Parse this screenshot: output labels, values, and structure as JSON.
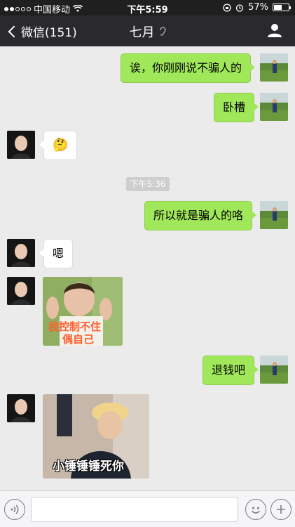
{
  "status_bar": {
    "carrier": "中国移动",
    "time": "下午5:59",
    "battery": "57%",
    "battery_level": 0.57
  },
  "nav": {
    "back_label": "微信(151)",
    "title": "七月"
  },
  "messages": {
    "m1": "诶，你刚刚说不骗人的",
    "m2": "卧槽",
    "m3_emoji": "🤔",
    "timestamp": "下午5:36",
    "m4": "所以就是骗人的咯",
    "m5": "嗯",
    "sticker1_line1": "我控制不住",
    "sticker1_line2": "偶自己",
    "m6": "退钱吧",
    "sticker2_caption": "小锤锤锤死你"
  },
  "input_bar": {
    "voice_icon": "voice-icon",
    "emoji_icon": "emoji-icon",
    "plus_icon": "plus-icon"
  }
}
